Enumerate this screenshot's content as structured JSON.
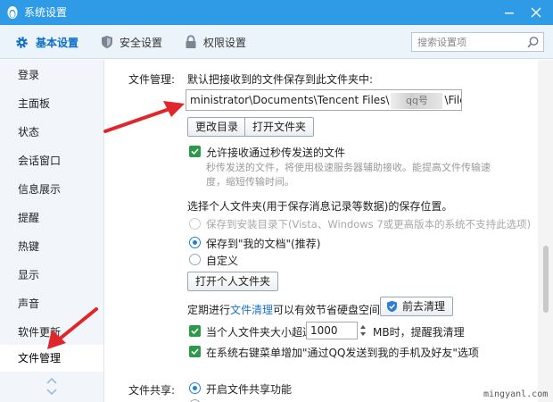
{
  "window": {
    "title": "系统设置",
    "min_icon": "minimize-icon",
    "close_icon": "close-icon"
  },
  "tabs": [
    {
      "label": "基本设置",
      "icon": "gear-icon",
      "active": true
    },
    {
      "label": "安全设置",
      "icon": "shield-icon",
      "active": false
    },
    {
      "label": "权限设置",
      "icon": "lock-icon",
      "active": false
    }
  ],
  "search": {
    "placeholder": "搜索设置项"
  },
  "sidebar": {
    "items": [
      {
        "label": "登录"
      },
      {
        "label": "主面板"
      },
      {
        "label": "状态"
      },
      {
        "label": "会话窗口"
      },
      {
        "label": "信息展示"
      },
      {
        "label": "提醒"
      },
      {
        "label": "热键"
      },
      {
        "label": "显示"
      },
      {
        "label": "声音"
      },
      {
        "label": "软件更新"
      },
      {
        "label": "文件管理",
        "active": true
      }
    ]
  },
  "file_mgmt": {
    "section_label": "文件管理:",
    "default_path_desc": "默认把接收到的文件保存到此文件夹中:",
    "path_before": "ministrator\\Documents\\Tencent Files\\",
    "path_masked": "qq号",
    "path_after": "\\FileRecv\\",
    "btn_change_dir": "更改目录",
    "btn_open_folder": "打开文件夹",
    "allow_flash_label": "允许接收通过秒传发送的文件",
    "allow_flash_desc_1": "秒传发送的文件，将使用极速服务器辅助接收。能提高文件传输速",
    "allow_flash_desc_2": "度，缩短传输时间。",
    "personal_folder_desc": "选择个人文件夹(用于保存消息记录等数据)的保存位置。",
    "opt_install_dir": "保存到安装目录下(Vista、Windows 7或更高版本的系统不支持此选项)",
    "opt_my_docs": "保存到\"我的文档\"(推荐)",
    "opt_custom": "自定义",
    "btn_open_personal": "打开个人文件夹",
    "cleanup_prefix": "定期进行",
    "cleanup_link": "文件清理",
    "cleanup_suffix": "可以有效节省硬盘空间。",
    "btn_cleanup": "前去清理",
    "size_prefix": "当个人文件夹大小超过",
    "size_value": "1000",
    "size_suffix": "MB时，提醒我清理",
    "context_menu_label": "在系统右键菜单增加\"通过QQ发送到我的手机及好友\"选项"
  },
  "file_share": {
    "section_label": "文件共享:",
    "enable_label": "开启文件共享功能"
  },
  "watermark": "mingyanl.com",
  "colors": {
    "titlebar": "#2f9be6",
    "accent": "#0b6dc9",
    "check": "#2d9a47",
    "arrow": "#e0262b"
  }
}
